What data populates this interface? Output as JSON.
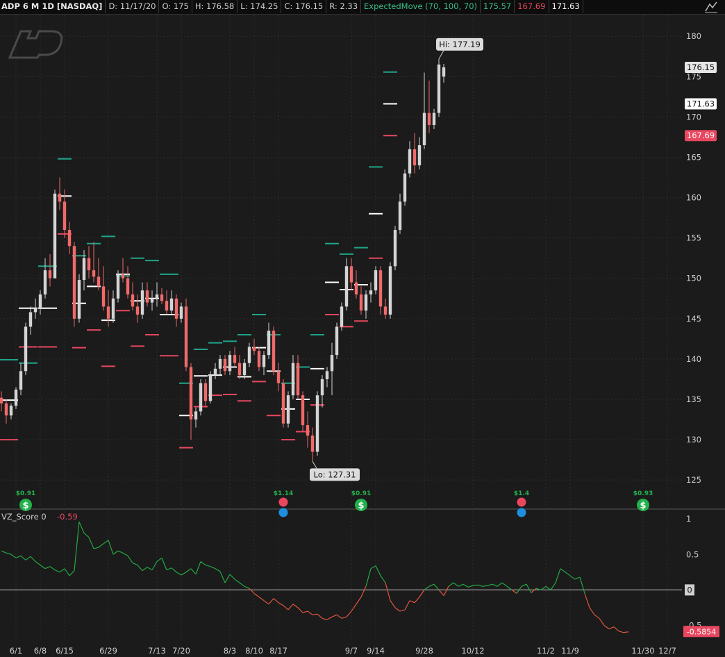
{
  "header": {
    "symbol": "ADP 6 M 1D [NASDAQ]",
    "date": "D: 11/17/20",
    "open": "O: 175",
    "high": "H: 176.58",
    "low": "L: 174.25",
    "close": "C: 176.15",
    "range": "R: 2.33",
    "study": "ExpectedMove (70, 100, 70)",
    "study_v1": "175.57",
    "study_v2": "167.69",
    "study_v3": "171.63"
  },
  "colors": {
    "up": "#d4d4d4",
    "down": "#f06a6a",
    "em_upper": "#1fa58a",
    "em_lower": "#e8475f",
    "em_mid": "#ffffff",
    "osc_pos": "#24a843",
    "osc_neg": "#e0553f",
    "dividend": "#23b14d",
    "earnings": "#e8475f",
    "info": "#1e8fe0"
  },
  "price_labels": {
    "current": "176.15",
    "upper": "171.63",
    "lower": "167.69"
  },
  "hi_callout": "Hi: 177.19",
  "lo_callout": "Lo: 127.31",
  "lower_panel": {
    "study": "VZ_Score",
    "param": "0",
    "value": "-0.59",
    "current_label": "-0.5854",
    "zero_label": "0"
  },
  "events": [
    {
      "label": "$0.91",
      "type": "dividend",
      "date_index": 5
    },
    {
      "label": "$1.14",
      "type": "earnings",
      "date_index": 58
    },
    {
      "label": "$0.91",
      "type": "dividend",
      "date_index": 74
    },
    {
      "label": "$1.4",
      "type": "earnings",
      "date_index": 107
    },
    {
      "label": "$0.93",
      "type": "dividend",
      "date_index": 132
    }
  ],
  "chart_data": {
    "type": "candlestick",
    "ticker": "ADP",
    "period": "6 M 1D",
    "ylim": [
      122,
      182
    ],
    "y_ticks": [
      125,
      130,
      135,
      140,
      145,
      150,
      155,
      160,
      165,
      170,
      175,
      180
    ],
    "x_tick_labels": [
      "6/1",
      "6/8",
      "6/15",
      "6/29",
      "7/13",
      "7/20",
      "8/3",
      "8/10",
      "8/17",
      "9/7",
      "9/14",
      "9/28",
      "10/12",
      "11/2",
      "11/9",
      "11/30",
      "12/7"
    ],
    "x_tick_index": [
      3,
      8,
      13,
      22,
      32,
      37,
      47,
      52,
      57,
      72,
      77,
      87,
      97,
      112,
      117,
      132,
      137
    ],
    "candles": [
      [
        135.2,
        136.0,
        133.5,
        134.5
      ],
      [
        134.5,
        135.0,
        132.0,
        133.0
      ],
      [
        133.0,
        134.5,
        132.5,
        134.2
      ],
      [
        134.2,
        136.5,
        133.8,
        136.2
      ],
      [
        136.2,
        139.5,
        135.5,
        138.5
      ],
      [
        138.5,
        144.5,
        138.0,
        144.0
      ],
      [
        144.0,
        146.5,
        143.0,
        145.8
      ],
      [
        145.8,
        147.5,
        145.0,
        146.2
      ],
      [
        146.2,
        148.5,
        145.5,
        148.0
      ],
      [
        148.0,
        152.5,
        147.5,
        151.0
      ],
      [
        151.0,
        153.0,
        149.0,
        150.0
      ],
      [
        150.0,
        161.0,
        150.0,
        160.5
      ],
      [
        160.5,
        162.5,
        158.5,
        159.5
      ],
      [
        159.5,
        161.0,
        155.0,
        156.0
      ],
      [
        156.0,
        157.0,
        153.0,
        154.0
      ],
      [
        154.0,
        154.5,
        144.0,
        145.0
      ],
      [
        145.0,
        150.5,
        144.5,
        149.8
      ],
      [
        149.8,
        153.5,
        148.5,
        152.5
      ],
      [
        152.5,
        154.0,
        150.0,
        151.0
      ],
      [
        151.0,
        154.5,
        149.5,
        150.2
      ],
      [
        150.2,
        152.5,
        148.5,
        149.0
      ],
      [
        149.0,
        151.5,
        146.0,
        146.5
      ],
      [
        146.5,
        148.5,
        144.0,
        145.0
      ],
      [
        145.0,
        148.5,
        144.5,
        147.5
      ],
      [
        147.5,
        151.0,
        147.0,
        150.5
      ],
      [
        150.5,
        152.5,
        149.5,
        150.0
      ],
      [
        150.0,
        151.5,
        147.5,
        148.0
      ],
      [
        148.0,
        149.5,
        146.0,
        146.5
      ],
      [
        146.5,
        148.0,
        144.5,
        145.5
      ],
      [
        145.5,
        149.5,
        145.0,
        148.5
      ],
      [
        148.5,
        149.5,
        146.5,
        147.0
      ],
      [
        147.0,
        148.5,
        146.0,
        147.5
      ],
      [
        147.5,
        149.5,
        146.5,
        148.0
      ],
      [
        148.0,
        148.8,
        146.8,
        147.2
      ],
      [
        147.2,
        148.5,
        145.5,
        146.0
      ],
      [
        146.0,
        148.5,
        145.5,
        147.5
      ],
      [
        147.5,
        148.0,
        144.0,
        145.0
      ],
      [
        145.0,
        147.0,
        144.5,
        146.5
      ],
      [
        146.5,
        147.5,
        138.5,
        139.0
      ],
      [
        139.0,
        139.5,
        130.0,
        132.5
      ],
      [
        132.5,
        134.0,
        131.5,
        133.5
      ],
      [
        133.5,
        137.5,
        133.0,
        137.0
      ],
      [
        137.0,
        137.5,
        134.0,
        134.8
      ],
      [
        134.8,
        138.5,
        134.5,
        138.0
      ],
      [
        138.0,
        139.5,
        137.5,
        138.8
      ],
      [
        138.8,
        140.5,
        138.0,
        140.0
      ],
      [
        140.0,
        140.5,
        138.0,
        138.5
      ],
      [
        138.5,
        141.0,
        138.0,
        140.5
      ],
      [
        140.5,
        141.5,
        139.0,
        139.5
      ],
      [
        139.5,
        140.5,
        137.5,
        138.0
      ],
      [
        138.0,
        140.0,
        137.5,
        139.5
      ],
      [
        139.5,
        142.0,
        139.0,
        141.5
      ],
      [
        141.5,
        142.5,
        140.5,
        141.0
      ],
      [
        141.0,
        141.5,
        138.5,
        139.0
      ],
      [
        139.0,
        141.0,
        138.0,
        140.5
      ],
      [
        140.5,
        144.5,
        140.0,
        143.5
      ],
      [
        143.5,
        144.0,
        138.0,
        138.5
      ],
      [
        138.5,
        139.5,
        136.0,
        137.0
      ],
      [
        137.0,
        137.5,
        131.5,
        132.0
      ],
      [
        132.0,
        136.0,
        131.5,
        135.5
      ],
      [
        135.5,
        140.5,
        135.0,
        139.5
      ],
      [
        139.5,
        140.5,
        135.0,
        135.5
      ],
      [
        135.5,
        136.0,
        131.0,
        131.8
      ],
      [
        131.8,
        133.5,
        129.0,
        130.5
      ],
      [
        130.5,
        131.5,
        127.3,
        128.5
      ],
      [
        128.5,
        136.0,
        128.0,
        135.5
      ],
      [
        135.5,
        138.0,
        134.0,
        137.5
      ],
      [
        137.5,
        139.0,
        136.5,
        138.5
      ],
      [
        138.5,
        142.0,
        135.5,
        140.5
      ],
      [
        140.5,
        144.5,
        140.0,
        144.0
      ],
      [
        144.0,
        147.0,
        143.5,
        146.5
      ],
      [
        146.5,
        152.5,
        146.0,
        151.5
      ],
      [
        151.5,
        152.5,
        148.5,
        149.5
      ],
      [
        149.5,
        151.0,
        147.5,
        148.0
      ],
      [
        148.0,
        149.0,
        145.5,
        146.0
      ],
      [
        146.0,
        148.5,
        145.0,
        148.0
      ],
      [
        148.0,
        149.5,
        147.0,
        148.5
      ],
      [
        148.5,
        151.5,
        148.0,
        151.0
      ],
      [
        151.0,
        151.5,
        145.5,
        146.5
      ],
      [
        146.5,
        147.5,
        145.0,
        145.5
      ],
      [
        145.5,
        152.0,
        145.0,
        151.5
      ],
      [
        151.5,
        156.5,
        151.0,
        156.0
      ],
      [
        156.0,
        160.5,
        155.5,
        159.5
      ],
      [
        159.5,
        163.5,
        159.0,
        163.0
      ],
      [
        163.0,
        167.0,
        162.5,
        166.0
      ],
      [
        166.0,
        168.0,
        163.0,
        164.0
      ],
      [
        164.0,
        167.5,
        163.5,
        166.5
      ],
      [
        166.5,
        175.5,
        166.0,
        170.5
      ],
      [
        170.5,
        174.5,
        168.0,
        169.0
      ],
      [
        169.0,
        171.0,
        168.5,
        170.5
      ],
      [
        170.5,
        177.19,
        170.0,
        176.5
      ],
      [
        175.0,
        176.58,
        174.25,
        176.15
      ]
    ],
    "expected_move": [
      {
        "start": 0,
        "end": 3,
        "upper": 139.9,
        "mid": 134.9,
        "lower": 130.0
      },
      {
        "start": 4,
        "end": 7,
        "upper": 139.5,
        "mid": 146.3,
        "lower": 141.5
      },
      {
        "start": 8,
        "end": 11,
        "upper": 151.5,
        "mid": 146.3,
        "lower": 141.5
      },
      {
        "start": 12,
        "end": 14,
        "upper": 164.8,
        "mid": 160.2,
        "lower": 155.5
      },
      {
        "start": 15,
        "end": 17,
        "upper": 152.8,
        "mid": 146.9,
        "lower": 141.4
      },
      {
        "start": 18,
        "end": 20,
        "upper": 154.3,
        "mid": 149.0,
        "lower": 143.6
      },
      {
        "start": 21,
        "end": 23,
        "upper": 155.2,
        "mid": 144.8,
        "lower": 139.1
      },
      {
        "start": 24,
        "end": 26,
        "upper": 150.3,
        "mid": 150.5,
        "lower": 146.0
      },
      {
        "start": 27,
        "end": 29,
        "upper": 152.5,
        "mid": 147.2,
        "lower": 141.6
      },
      {
        "start": 30,
        "end": 32,
        "upper": 152.2,
        "mid": 147.5,
        "lower": 143.0
      },
      {
        "start": 33,
        "end": 36,
        "upper": 150.5,
        "mid": 145.5,
        "lower": 140.4
      },
      {
        "start": 37,
        "end": 39,
        "upper": 137.0,
        "mid": 133.0,
        "lower": 129.0
      },
      {
        "start": 40,
        "end": 42,
        "upper": 141.2,
        "mid": 137.9,
        "lower": 134.1
      },
      {
        "start": 43,
        "end": 45,
        "upper": 142.0,
        "mid": 138.0,
        "lower": 135.5
      },
      {
        "start": 46,
        "end": 48,
        "upper": 142.2,
        "mid": 139.0,
        "lower": 135.6
      },
      {
        "start": 49,
        "end": 51,
        "upper": 143.0,
        "mid": 137.8,
        "lower": 134.8
      },
      {
        "start": 52,
        "end": 54,
        "upper": 145.5,
        "mid": 141.4,
        "lower": 137.2
      },
      {
        "start": 55,
        "end": 57,
        "upper": 143.0,
        "mid": 138.5,
        "lower": 133.0
      },
      {
        "start": 58,
        "end": 60,
        "upper": 137.0,
        "mid": 133.8,
        "lower": 130.0
      },
      {
        "start": 61,
        "end": 63,
        "upper": 139.0,
        "mid": 135.0,
        "lower": 131.0
      },
      {
        "start": 64,
        "end": 66,
        "upper": 143.0,
        "mid": 138.8,
        "lower": 134.3
      },
      {
        "start": 67,
        "end": 69,
        "upper": 154.3,
        "mid": 149.5,
        "lower": 145.5
      },
      {
        "start": 70,
        "end": 72,
        "upper": 153.0,
        "mid": 148.6,
        "lower": 144.0
      },
      {
        "start": 73,
        "end": 75,
        "upper": 153.8,
        "mid": 149.2,
        "lower": 144.7
      },
      {
        "start": 76,
        "end": 78,
        "upper": 163.8,
        "mid": 158.0,
        "lower": 152.5
      },
      {
        "start": 79,
        "end": 81,
        "upper": 175.57,
        "mid": 171.63,
        "lower": 167.69
      }
    ],
    "vz_score": {
      "ylim": [
        -0.7,
        1.05
      ],
      "y_ticks": [
        1,
        0.5,
        0,
        -0.5
      ],
      "values": [
        0.55,
        0.52,
        0.5,
        0.45,
        0.48,
        0.42,
        0.47,
        0.4,
        0.35,
        0.3,
        0.33,
        0.28,
        0.25,
        0.3,
        0.2,
        0.27,
        0.96,
        0.8,
        0.74,
        0.58,
        0.6,
        0.65,
        0.7,
        0.5,
        0.55,
        0.52,
        0.48,
        0.38,
        0.35,
        0.27,
        0.32,
        0.28,
        0.4,
        0.45,
        0.28,
        0.31,
        0.25,
        0.21,
        0.25,
        0.3,
        0.22,
        0.4,
        0.35,
        0.33,
        0.3,
        0.26,
        0.1,
        0.22,
        0.15,
        0.1,
        0.05,
        0.02,
        -0.05,
        -0.1,
        -0.15,
        -0.2,
        -0.12,
        -0.18,
        -0.22,
        -0.28,
        -0.2,
        -0.25,
        -0.32,
        -0.3,
        -0.35,
        -0.34,
        -0.4,
        -0.42,
        -0.38,
        -0.35,
        -0.4,
        -0.38,
        -0.3,
        -0.2,
        -0.1,
        0.05,
        0.3,
        0.34,
        0.2,
        0.1,
        -0.15,
        -0.25,
        -0.3,
        -0.28,
        -0.15,
        -0.18,
        -0.1,
        0.0,
        0.05,
        0.08,
        0.0,
        -0.08,
        0.05,
        0.1,
        0.05,
        0.08,
        0.04,
        0.06,
        0.07,
        0.05,
        0.06,
        0.08,
        0.05,
        0.1,
        0.05,
        0.0,
        -0.05,
        0.05,
        0.08,
        -0.04,
        0.02,
        0.0,
        0.05,
        0.0,
        0.1,
        0.3,
        0.25,
        0.2,
        0.15,
        0.18,
        -0.05,
        -0.25,
        -0.35,
        -0.4,
        -0.5,
        -0.55,
        -0.52,
        -0.58,
        -0.6,
        -0.59
      ]
    }
  }
}
